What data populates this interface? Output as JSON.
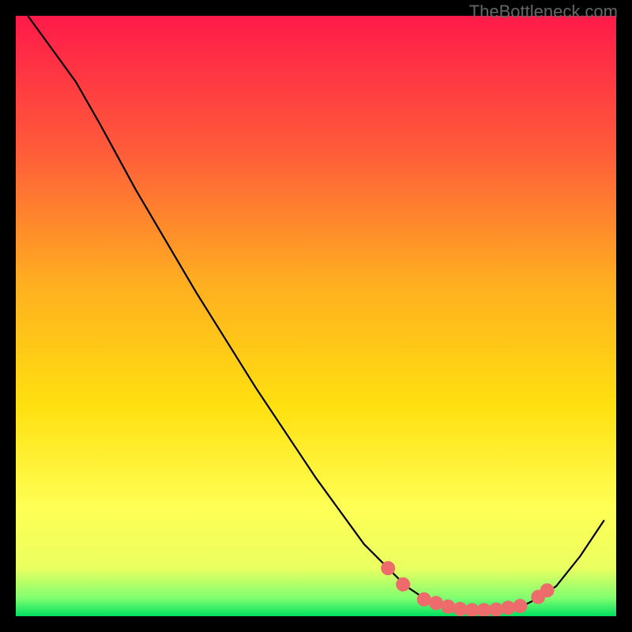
{
  "watermark": "TheBottleneck.com",
  "chart_data": {
    "type": "line",
    "title": "",
    "xlabel": "",
    "ylabel": "",
    "xlim": [
      0,
      100
    ],
    "ylim": [
      0,
      100
    ],
    "background_gradient": {
      "top": "#ff1a4a",
      "upper_mid": "#ff7a2a",
      "mid": "#ffd700",
      "lower_mid": "#ffff66",
      "bottom": "#00e060"
    },
    "curve": {
      "name": "bottleneck-curve",
      "color": "#000000",
      "points": [
        {
          "x": 2,
          "y": 100
        },
        {
          "x": 10,
          "y": 89
        },
        {
          "x": 14,
          "y": 82
        },
        {
          "x": 20,
          "y": 71
        },
        {
          "x": 30,
          "y": 54
        },
        {
          "x": 40,
          "y": 38
        },
        {
          "x": 50,
          "y": 23
        },
        {
          "x": 58,
          "y": 12
        },
        {
          "x": 62,
          "y": 8
        },
        {
          "x": 65,
          "y": 5
        },
        {
          "x": 68,
          "y": 3
        },
        {
          "x": 72,
          "y": 1.5
        },
        {
          "x": 76,
          "y": 1
        },
        {
          "x": 80,
          "y": 1
        },
        {
          "x": 84,
          "y": 1.5
        },
        {
          "x": 87,
          "y": 3
        },
        {
          "x": 90,
          "y": 5
        },
        {
          "x": 94,
          "y": 10
        },
        {
          "x": 98,
          "y": 16
        }
      ]
    },
    "markers": {
      "color": "#ee6b6b",
      "radius": 9,
      "points": [
        {
          "x": 62,
          "y": 8
        },
        {
          "x": 64.5,
          "y": 5.3
        },
        {
          "x": 68,
          "y": 2.8
        },
        {
          "x": 70,
          "y": 2.2
        },
        {
          "x": 72,
          "y": 1.6
        },
        {
          "x": 74,
          "y": 1.2
        },
        {
          "x": 76,
          "y": 1.0
        },
        {
          "x": 78,
          "y": 1.0
        },
        {
          "x": 80,
          "y": 1.1
        },
        {
          "x": 82,
          "y": 1.4
        },
        {
          "x": 84,
          "y": 1.7
        },
        {
          "x": 87,
          "y": 3.2
        },
        {
          "x": 88.5,
          "y": 4.3
        }
      ]
    }
  }
}
